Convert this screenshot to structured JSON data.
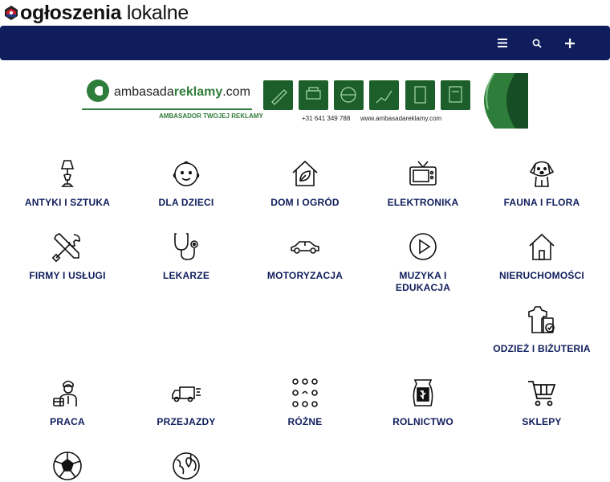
{
  "brand": {
    "bold": "ogłoszenia",
    "light": " lokalne"
  },
  "nav": {
    "menu_icon": "hamburger-icon",
    "search_icon": "search-icon",
    "add_icon": "plus-icon"
  },
  "banner": {
    "site_pre": "ambasada",
    "site_bold": "reklamy",
    "site_post": ".com",
    "tagline": "AMBASADOR TWOJEJ REKLAMY",
    "phone": "+31 641 349 788",
    "url": "www.ambasadareklamy.com"
  },
  "colors": {
    "navbar": "#0f1d5c",
    "label": "#0f1d5c",
    "banner_green": "#2f7d3a"
  },
  "categories": [
    {
      "label": "ANTYKI I SZTUKA",
      "icon": "lamp-icon"
    },
    {
      "label": "DLA DZIECI",
      "icon": "baby-icon"
    },
    {
      "label": "DOM I OGRÓD",
      "icon": "house-leaf-icon"
    },
    {
      "label": "ELEKTRONIKA",
      "icon": "tv-icon"
    },
    {
      "label": "FAUNA I FLORA",
      "icon": "dog-icon"
    },
    {
      "label": "FIRMY I USŁUGI",
      "icon": "tools-icon"
    },
    {
      "label": "LEKARZE",
      "icon": "stethoscope-icon"
    },
    {
      "label": "MOTORYZACJA",
      "icon": "car-icon"
    },
    {
      "label": "MUZYKA I EDUKACJA",
      "icon": "play-icon"
    },
    {
      "label": "NIERUCHOMOŚCI",
      "icon": "home-icon"
    },
    {
      "label": "ODZIEŻ I BIŻUTERIA",
      "icon": "clothes-icon"
    },
    {
      "label": "PRACA",
      "icon": "worker-icon"
    },
    {
      "label": "PRZEJAZDY",
      "icon": "truck-icon"
    },
    {
      "label": "RÓŻNE",
      "icon": "dots-grid-icon"
    },
    {
      "label": "ROLNICTWO",
      "icon": "grain-sack-icon"
    },
    {
      "label": "SKLEPY",
      "icon": "cart-icon"
    },
    {
      "label": "",
      "icon": "football-icon"
    },
    {
      "label": "",
      "icon": "globe-pin-icon"
    }
  ]
}
